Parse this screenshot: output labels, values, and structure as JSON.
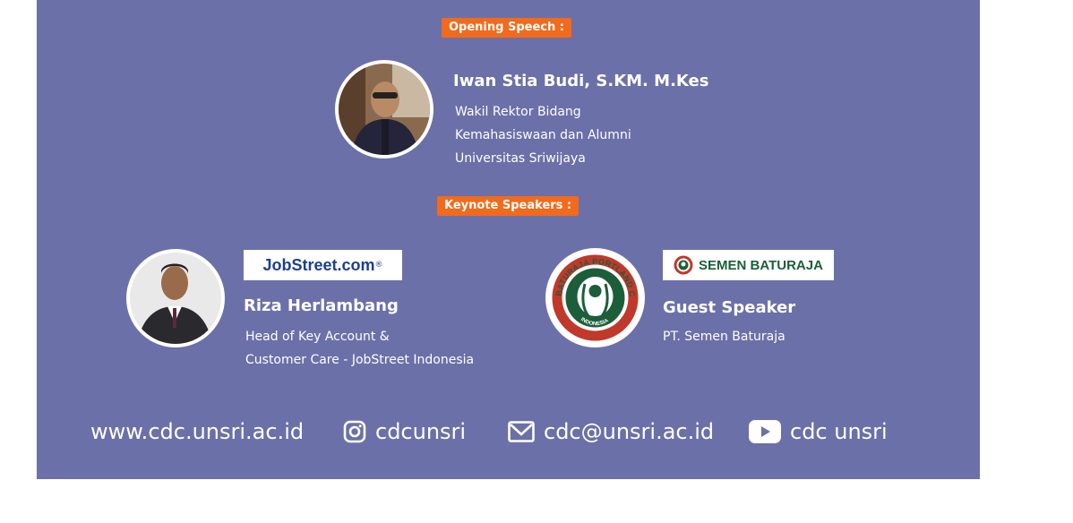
{
  "opening": {
    "label": "Opening Speech :",
    "speaker_name": "Iwan Stia Budi, S.KM. M.Kes",
    "role_lines": [
      "Wakil Rektor Bidang",
      "Kemahasiswaan dan Alumni",
      "Universitas Sriwijaya"
    ]
  },
  "keynote": {
    "label": "Keynote Speakers :",
    "speakers": [
      {
        "logo_text": "JobStreet.com",
        "logo_mark": "®",
        "name": "Riza Herlambang",
        "role_lines": [
          "Head of Key Account &",
          "Customer Care - JobStreet Indonesia"
        ]
      },
      {
        "logo_text": "SEMEN BATURAJA",
        "seal_text": "BATURAJA PORTLAND CEMENT",
        "seal_sub": "INDONESIA",
        "name": "Guest Speaker",
        "role_lines": [
          "PT. Semen Baturaja"
        ]
      }
    ]
  },
  "footer": {
    "website": "www.cdc.unsri.ac.id",
    "instagram": "cdcunsri",
    "email": "cdc@unsri.ac.id",
    "youtube": "cdc unsri"
  },
  "colors": {
    "background": "#6c70a8",
    "accent": "#f26a1b",
    "jobstreet_blue": "#1d3f8f",
    "semen_green": "#1c5e3a"
  },
  "icons": [
    "instagram-icon",
    "mail-icon",
    "youtube-icon"
  ]
}
